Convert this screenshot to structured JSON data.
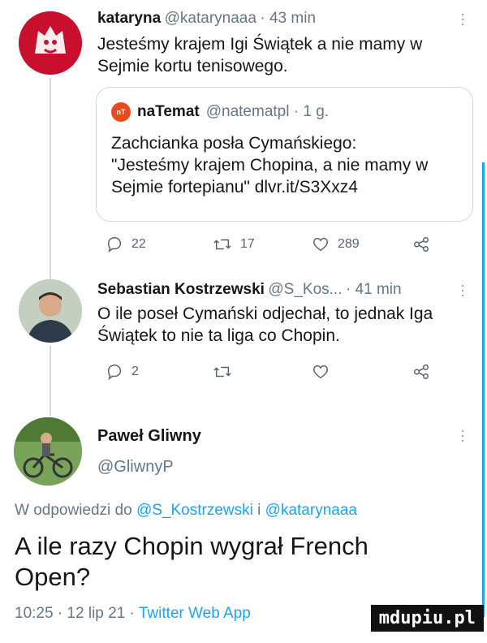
{
  "tweet1": {
    "name": "kataryna",
    "handle": "@katarynaaa",
    "time": "· 43 min",
    "text_line1": "Jesteśmy krajem Igi Świątek a nie mamy w",
    "text_line2": "Sejmie kortu tenisowego.",
    "quote": {
      "name": "naTemat",
      "handle": "@natematpl · 1 g.",
      "line1": "Zachcianka posła Cymańskiego:",
      "line2": "\"Jesteśmy krajem Chopina, a nie mamy w",
      "line3": "Sejmie fortepianu\" dlvr.it/S3Xxz4"
    },
    "replies": "22",
    "retweets": "17",
    "likes": "289"
  },
  "tweet2": {
    "name": "Sebastian Kostrzewski",
    "handle": "@S_Kos...",
    "time": "· 41 min",
    "text_line1": "O ile poseł Cymański odjechał, to jednak Iga",
    "text_line2": "Świątek to nie ta liga co Chopin.",
    "replies": "2",
    "retweets": "",
    "likes": ""
  },
  "tweet3": {
    "name": "Paweł Gliwny",
    "handle": "@GliwnyP",
    "reply_prefix": "W odpowiedzi do",
    "reply_to_1": "@S_Kostrzewski",
    "reply_and": "i",
    "reply_to_2": "@katarynaaa",
    "text_line1": "A ile razy Chopin wygrał French",
    "text_line2": "Open?",
    "footer_time": "10:25 · 12 lip 21 ·",
    "footer_client": "Twitter Web App"
  },
  "watermark": "mdupiu.pl",
  "colors": {
    "link": "#1da1f2",
    "text": "#14171a",
    "muted": "#657786",
    "border": "#cfd9de"
  },
  "icons": [
    "reply-icon",
    "retweet-icon",
    "like-icon",
    "share-icon",
    "more-icon"
  ]
}
